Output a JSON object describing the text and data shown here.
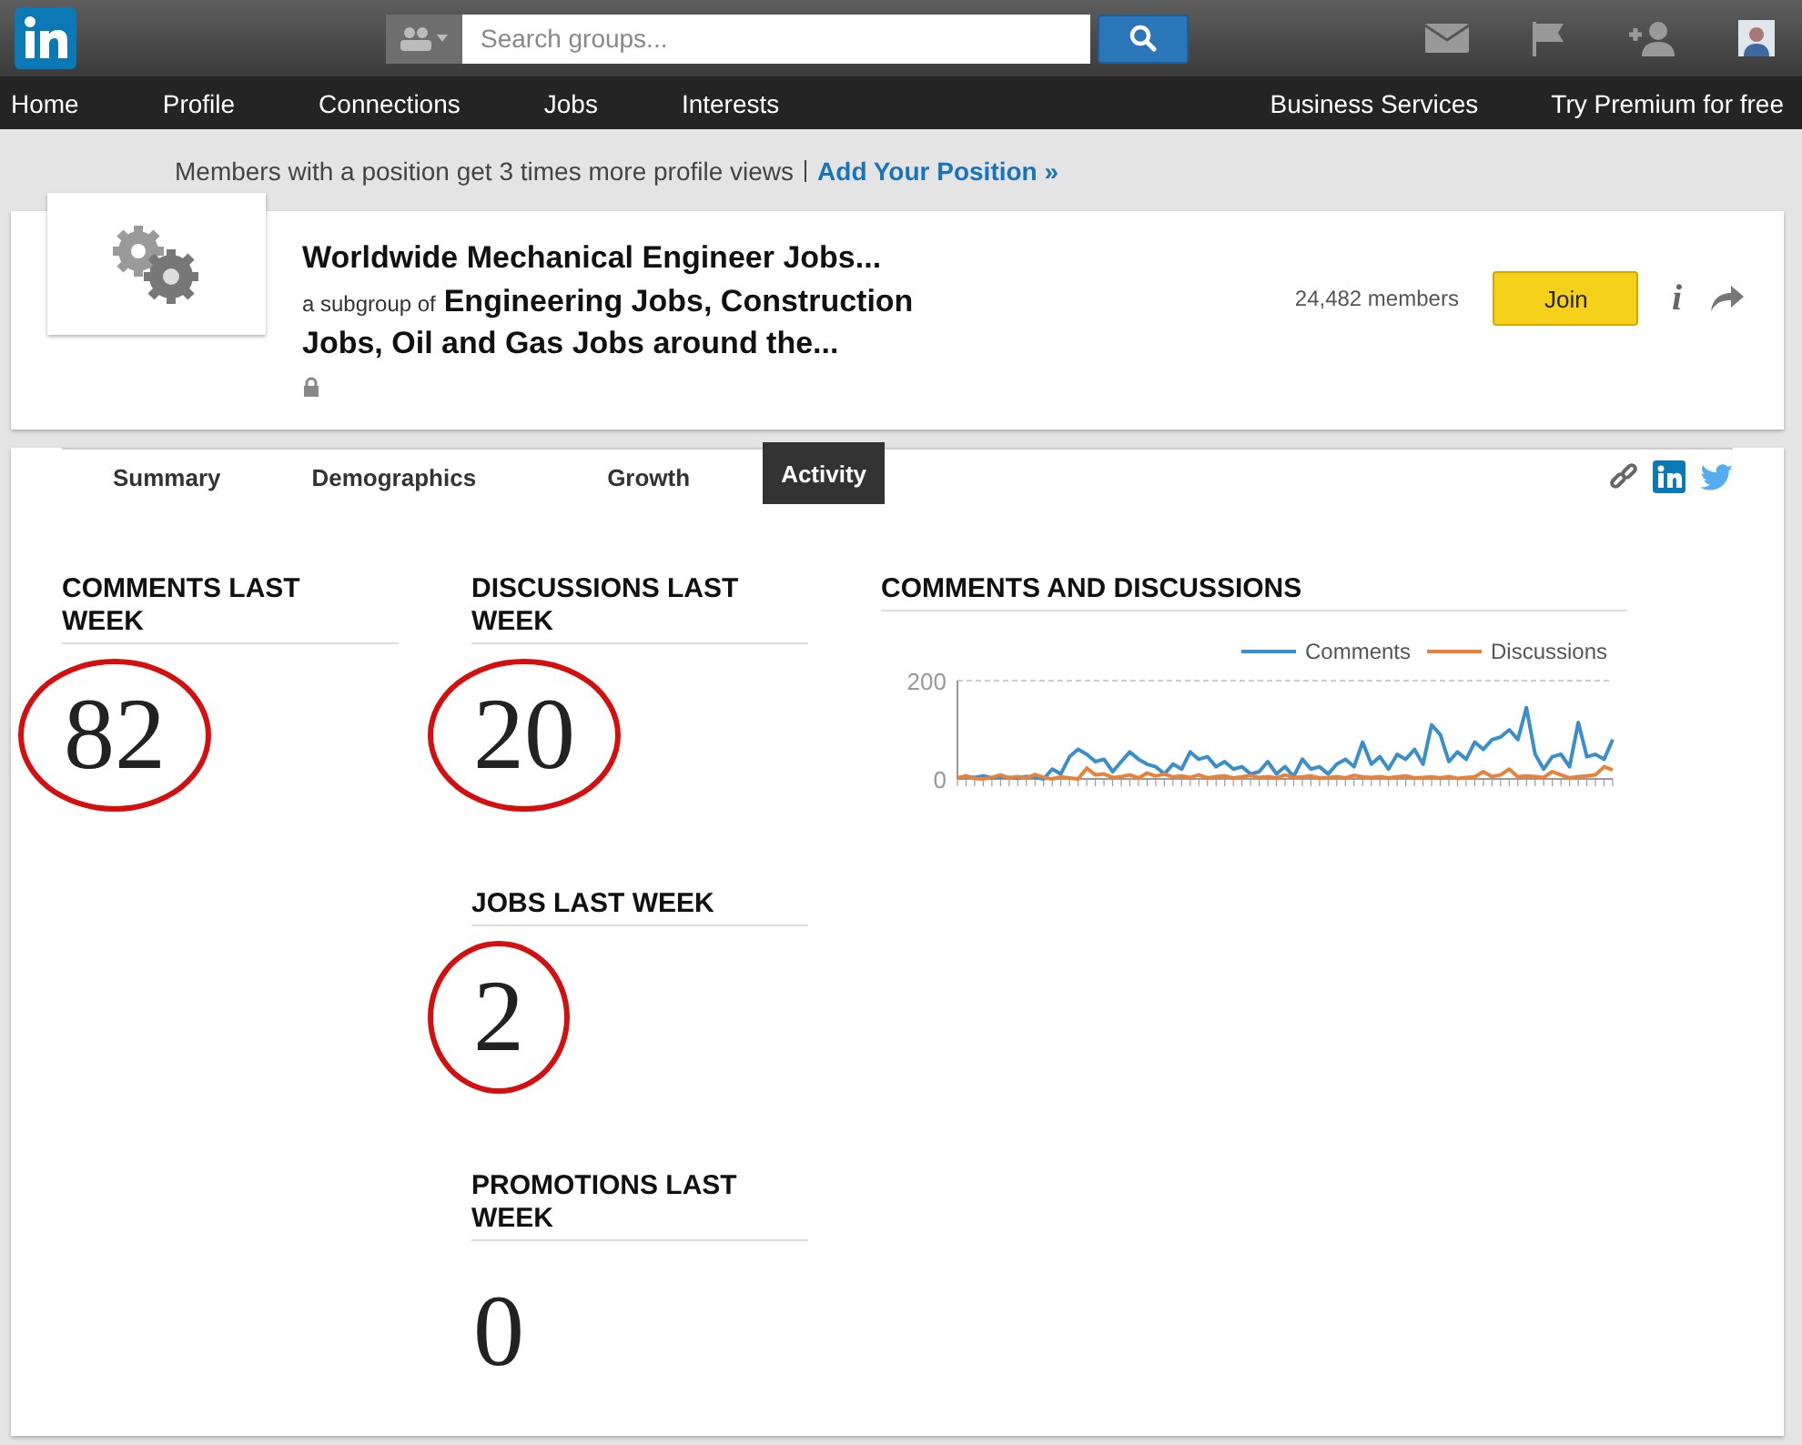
{
  "search": {
    "placeholder": "Search groups..."
  },
  "nav": {
    "left": [
      {
        "label": "Home"
      },
      {
        "label": "Profile"
      },
      {
        "label": "Connections"
      },
      {
        "label": "Jobs"
      },
      {
        "label": "Interests"
      }
    ],
    "right": [
      {
        "label": "Business Services"
      },
      {
        "label": "Try Premium for free"
      }
    ]
  },
  "promo": {
    "text": "Members with a position get 3 times more profile views",
    "link": "Add Your Position »"
  },
  "group": {
    "title": "Worldwide Mechanical Engineer Jobs...",
    "subgroup_prefix": "a subgroup of",
    "parent": "Engineering Jobs, Construction Jobs, Oil and Gas Jobs around the...",
    "members": "24,482 members",
    "join": "Join",
    "info": "i"
  },
  "tabs": [
    {
      "label": "Summary",
      "selected": false
    },
    {
      "label": "Demographics",
      "selected": false
    },
    {
      "label": "Growth",
      "selected": false
    },
    {
      "label": "Activity",
      "selected": true
    }
  ],
  "stats": [
    {
      "title": "COMMENTS LAST WEEK",
      "value": "82",
      "circled": true
    },
    {
      "title": "DISCUSSIONS LAST WEEK",
      "value": "20",
      "circled": true
    },
    {
      "title": "JOBS LAST WEEK",
      "value": "2",
      "circled": true
    },
    {
      "title": "PROMOTIONS LAST WEEK",
      "value": "0",
      "circled": false
    }
  ],
  "chart": {
    "title": "COMMENTS AND DISCUSSIONS",
    "chart_data": {
      "type": "line",
      "legend": "top-right",
      "ylim": [
        0,
        200
      ],
      "yticks": [
        0,
        200
      ],
      "series": [
        {
          "name": "Comments",
          "color": "#3a8fcb",
          "values": [
            2,
            5,
            3,
            6,
            2,
            4,
            3,
            2,
            5,
            3,
            0,
            20,
            10,
            45,
            60,
            50,
            35,
            40,
            15,
            35,
            55,
            40,
            30,
            25,
            10,
            30,
            20,
            55,
            40,
            45,
            25,
            35,
            20,
            25,
            10,
            15,
            35,
            10,
            25,
            5,
            40,
            20,
            25,
            10,
            30,
            40,
            25,
            75,
            30,
            45,
            20,
            50,
            40,
            60,
            30,
            110,
            90,
            35,
            55,
            40,
            75,
            60,
            80,
            85,
            100,
            80,
            145,
            50,
            20,
            45,
            50,
            25,
            115,
            45,
            50,
            40,
            80
          ]
        },
        {
          "name": "Discussions",
          "color": "#e8823b",
          "values": [
            2,
            6,
            1,
            0,
            3,
            8,
            2,
            5,
            1,
            9,
            3,
            0,
            4,
            2,
            0,
            22,
            8,
            10,
            3,
            5,
            8,
            2,
            12,
            6,
            10,
            4,
            6,
            3,
            8,
            2,
            5,
            6,
            2,
            4,
            7,
            3,
            5,
            2,
            8,
            3,
            4,
            6,
            2,
            3,
            5,
            2,
            7,
            4,
            3,
            5,
            2,
            4,
            6,
            2,
            3,
            4,
            2,
            5,
            1,
            3,
            4,
            15,
            5,
            8,
            20,
            4,
            6,
            5,
            3,
            15,
            8,
            2,
            5,
            6,
            8,
            25,
            18
          ]
        }
      ]
    }
  }
}
